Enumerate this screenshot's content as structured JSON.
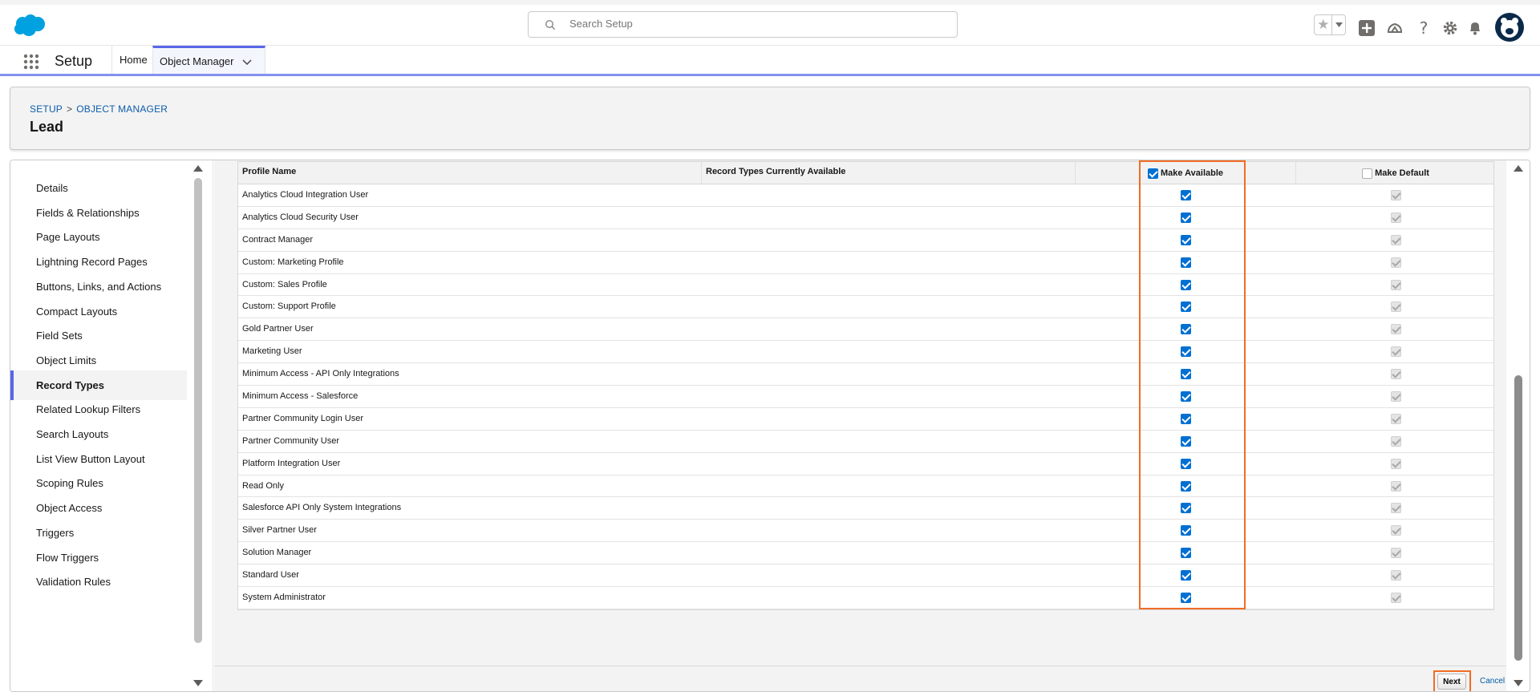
{
  "header": {
    "search_placeholder": "Search Setup",
    "icons": [
      "favorites-star-icon",
      "favorites-dropdown-icon",
      "global-actions-plus-icon",
      "trailhead-icon",
      "help-icon",
      "settings-gear-icon",
      "notifications-bell-icon",
      "user-avatar"
    ]
  },
  "context": {
    "app_name": "Setup",
    "tabs": [
      {
        "label": "Home"
      },
      {
        "label": "Object Manager"
      }
    ]
  },
  "page_header": {
    "breadcrumb_1": "SETUP",
    "breadcrumb_sep": ">",
    "breadcrumb_2": "OBJECT MANAGER",
    "title": "Lead"
  },
  "sidebar": {
    "items": [
      {
        "label": "Details"
      },
      {
        "label": "Fields & Relationships"
      },
      {
        "label": "Page Layouts"
      },
      {
        "label": "Lightning Record Pages"
      },
      {
        "label": "Buttons, Links, and Actions"
      },
      {
        "label": "Compact Layouts"
      },
      {
        "label": "Field Sets"
      },
      {
        "label": "Object Limits"
      },
      {
        "label": "Record Types",
        "active": true
      },
      {
        "label": "Related Lookup Filters"
      },
      {
        "label": "Search Layouts"
      },
      {
        "label": "List View Button Layout"
      },
      {
        "label": "Scoping Rules"
      },
      {
        "label": "Object Access"
      },
      {
        "label": "Triggers"
      },
      {
        "label": "Flow Triggers"
      },
      {
        "label": "Validation Rules"
      }
    ]
  },
  "grid": {
    "col_profile": "Profile Name",
    "col_record_types": "Record Types Currently Available",
    "col_make_available": "Make Available",
    "col_make_default": "Make Default",
    "header_make_available_checked": true,
    "header_make_default_checked": false,
    "rows": [
      {
        "name": "Analytics Cloud Integration User",
        "available": true,
        "default": true
      },
      {
        "name": "Analytics Cloud Security User",
        "available": true,
        "default": true
      },
      {
        "name": "Contract Manager",
        "available": true,
        "default": true
      },
      {
        "name": "Custom: Marketing Profile",
        "available": true,
        "default": true
      },
      {
        "name": "Custom: Sales Profile",
        "available": true,
        "default": true
      },
      {
        "name": "Custom: Support Profile",
        "available": true,
        "default": true
      },
      {
        "name": "Gold Partner User",
        "available": true,
        "default": true
      },
      {
        "name": "Marketing User",
        "available": true,
        "default": true
      },
      {
        "name": "Minimum Access - API Only Integrations",
        "available": true,
        "default": true
      },
      {
        "name": "Minimum Access - Salesforce",
        "available": true,
        "default": true
      },
      {
        "name": "Partner Community Login User",
        "available": true,
        "default": true
      },
      {
        "name": "Partner Community User",
        "available": true,
        "default": true
      },
      {
        "name": "Platform Integration User",
        "available": true,
        "default": true
      },
      {
        "name": "Read Only",
        "available": true,
        "default": true
      },
      {
        "name": "Salesforce API Only System Integrations",
        "available": true,
        "default": true
      },
      {
        "name": "Silver Partner User",
        "available": true,
        "default": true
      },
      {
        "name": "Solution Manager",
        "available": true,
        "default": true
      },
      {
        "name": "Standard User",
        "available": true,
        "default": true
      },
      {
        "name": "System Administrator",
        "available": true,
        "default": true
      }
    ]
  },
  "footer": {
    "next_label": "Next",
    "cancel_label": "Cancel"
  },
  "colors": {
    "brand_blue": "#00a1e0",
    "accent_indigo": "#5867e8",
    "checkbox_blue": "#0070d2",
    "highlight_orange": "#f26c25"
  }
}
